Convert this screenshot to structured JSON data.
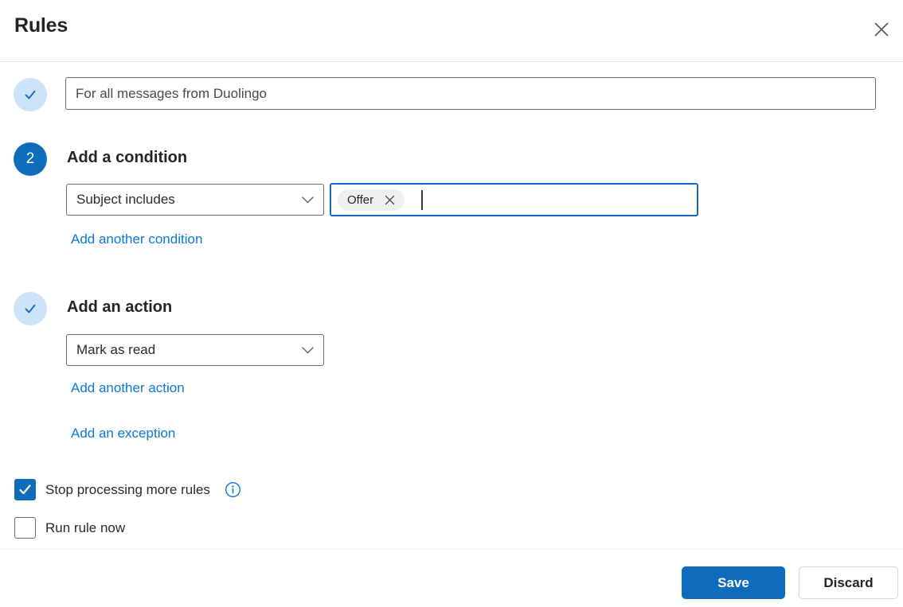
{
  "header": {
    "title": "Rules"
  },
  "rule_name": {
    "value": "For all messages from Duolingo",
    "status_complete": true
  },
  "condition": {
    "step_number": "2",
    "heading": "Add a condition",
    "dropdown_value": "Subject includes",
    "tag_label": "Offer",
    "add_link": "Add another condition"
  },
  "action": {
    "heading": "Add an action",
    "status_complete": true,
    "dropdown_value": "Mark as read",
    "add_link": "Add another action",
    "exception_link": "Add an exception"
  },
  "options": {
    "stop_processing": {
      "label": "Stop processing more rules",
      "checked": true
    },
    "run_now": {
      "label": "Run rule now",
      "checked": false
    }
  },
  "footer": {
    "save_label": "Save",
    "discard_label": "Discard"
  },
  "icons": {
    "close": "dismiss-x",
    "check": "checkmark",
    "chevron": "chevron-down",
    "info": "info-circle"
  },
  "colors": {
    "brand": "#0f6cbd",
    "link": "#0a78d5",
    "step_complete_bg": "#cde3f7",
    "input_border": "#6b6a68",
    "focus_border": "#1169bf",
    "pill_bg": "#f1f0ef",
    "divider": "#e8e8e8"
  }
}
